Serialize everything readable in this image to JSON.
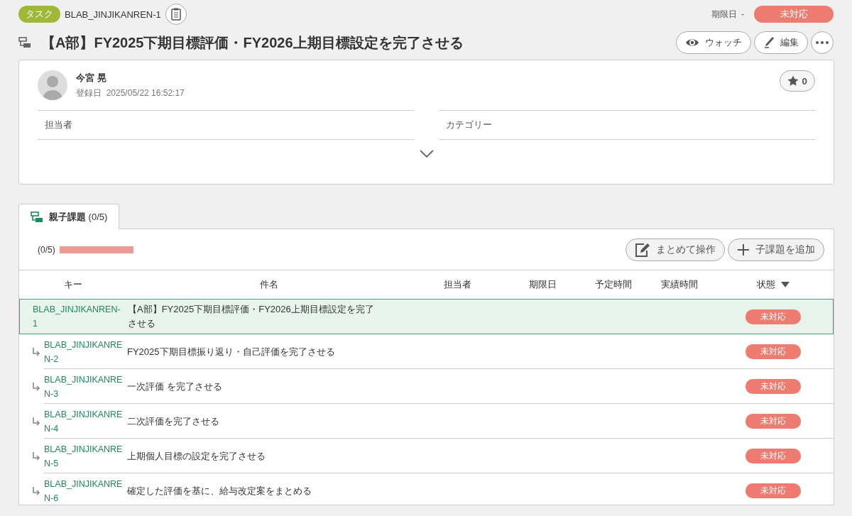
{
  "header": {
    "type_badge": "タスク",
    "issue_key": "BLAB_JINJIKANREN-1",
    "due_label": "期限日",
    "due_value": "-",
    "status": {
      "label": "未対応",
      "color": "#ee7b6f"
    }
  },
  "title": "【A部】FY2025下期目標評価・FY2026上期目標設定を完了させる",
  "actions": [
    {
      "kind": "watch",
      "label": "ウォッチ"
    },
    {
      "kind": "edit",
      "label": "編集"
    },
    {
      "kind": "more"
    }
  ],
  "author": {
    "name": "今宮 晃",
    "registered_label": "登録日",
    "registered_at": "2025/05/22 16:52:17"
  },
  "star_count": "0",
  "fields": [
    "担当者",
    "カテゴリー"
  ],
  "tabs": [
    {
      "label": "**親子課題** (0/5)",
      "selected": true
    }
  ],
  "progress": {
    "count": "(0/5)",
    "color": "#ee9a94"
  },
  "toolbar": [
    {
      "kind": "bulk",
      "label": "まとめて操作"
    },
    {
      "kind": "add",
      "label": "子課題を追加"
    }
  ],
  "table": {
    "columns": [
      "キー",
      "件名",
      "担当者",
      "期限日",
      "予定時間",
      "実績時間",
      "状態"
    ],
    "rows": [
      {
        "key": "BLAB_JINJIKANREN-1",
        "subject": "【A部】FY2025下期目標評価・FY2026上期目標設定を完了させる",
        "status": {
          "label": "未対応",
          "color": "#ee7b6f"
        },
        "selected": true,
        "children": [
          {
            "key": "BLAB_JINJIKANREN-2",
            "subject": "FY2025下期目標振り返り・自己評価を完了させる",
            "status": {
              "label": "未対応",
              "color": "#ee7b6f"
            },
            "selected": false
          },
          {
            "key": "BLAB_JINJIKANREN-3",
            "subject": "一次評価 を完了させる",
            "status": {
              "label": "未対応",
              "color": "#ee7b6f"
            },
            "selected": false
          },
          {
            "key": "BLAB_JINJIKANREN-4",
            "subject": "二次評価を完了させる",
            "status": {
              "label": "未対応",
              "color": "#ee7b6f"
            },
            "selected": false
          },
          {
            "key": "BLAB_JINJIKANREN-5",
            "subject": "上期個人目標の設定を完了させる",
            "status": {
              "label": "未対応",
              "color": "#ee7b6f"
            },
            "selected": false
          },
          {
            "key": "BLAB_JINJIKANREN-6",
            "subject": "確定した評価を基に、給与改定案をまとめる",
            "status": {
              "label": "未対応",
              "color": "#ee7b6f"
            },
            "selected": false
          }
        ]
      }
    ]
  }
}
